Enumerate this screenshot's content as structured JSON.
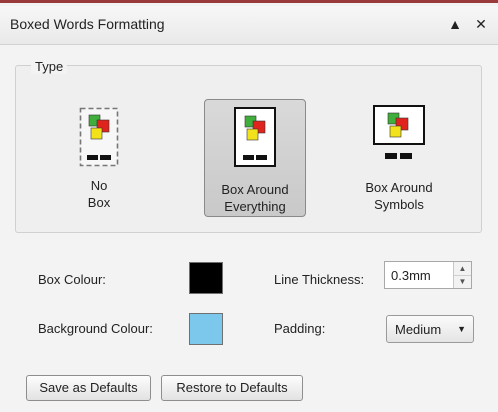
{
  "panel": {
    "title": "Boxed Words Formatting",
    "collapse_glyph": "▲",
    "close_glyph": "✕",
    "collapse_icon": "collapse-up-icon",
    "close_icon": "close-icon"
  },
  "type_group": {
    "legend": "Type",
    "options": [
      {
        "line1": "No",
        "line2": "Box",
        "selected": false,
        "icon": "no-box-icon"
      },
      {
        "line1": "Box Around",
        "line2": "Everything",
        "selected": true,
        "icon": "box-around-everything-icon"
      },
      {
        "line1": "Box Around",
        "line2": "Symbols",
        "selected": false,
        "icon": "box-around-symbols-icon"
      }
    ]
  },
  "box_colour": {
    "label": "Box Colour:",
    "color": "#000000"
  },
  "background_colour": {
    "label": "Background Colour:",
    "color": "#7cc8ec"
  },
  "line_thickness": {
    "label": "Line Thickness:",
    "value": "0.3mm",
    "up_glyph": "▲",
    "down_glyph": "▼"
  },
  "padding": {
    "label": "Padding:",
    "value": "Medium",
    "arrow_glyph": "▼"
  },
  "buttons": {
    "save_defaults": "Save as Defaults",
    "restore_defaults": "Restore to Defaults"
  },
  "colors": {
    "accent_border": "#9a3a3a",
    "symbol_green": "#3fae3a",
    "symbol_red": "#e0231c",
    "symbol_yellow": "#f2e21c"
  }
}
